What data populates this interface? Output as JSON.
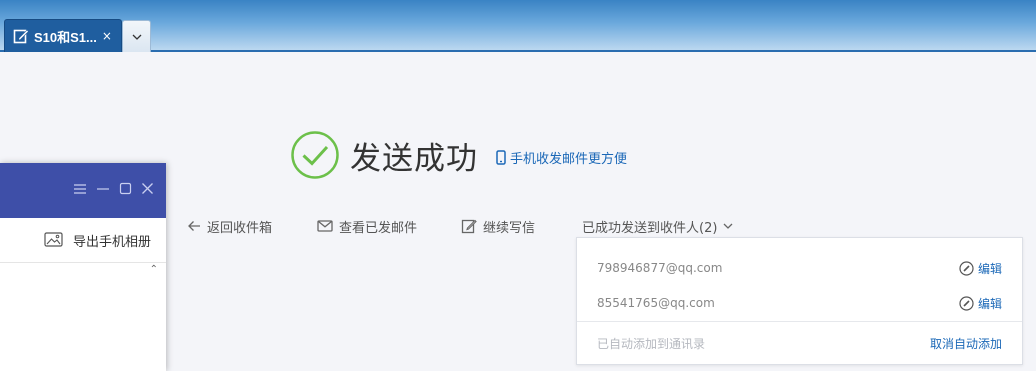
{
  "tabs": {
    "active_title": "S10和S1...",
    "close_glyph": "×",
    "more_glyph": "⌄"
  },
  "success": {
    "title": "发送成功",
    "mobile_link": "手机收发邮件更方便",
    "check_color": "#6cc04a"
  },
  "actions": {
    "back": "返回收件箱",
    "view_sent": "查看已发邮件",
    "continue_write": "继续写信",
    "sent_to": "已成功发送到收件人(2)"
  },
  "recipients": {
    "items": [
      {
        "email": "798946877@qq.com",
        "edit": "编辑"
      },
      {
        "email": "85541765@qq.com",
        "edit": "编辑"
      }
    ],
    "auto_added": "已自动添加到通讯录",
    "cancel_auto": "取消自动添加"
  },
  "side_window": {
    "export_album": "导出手机相册",
    "collapse_glyph": "⌃",
    "header_color": "#3e4fa8"
  },
  "colors": {
    "link": "#1b68b7",
    "tab_active": "#1f5e9f"
  }
}
